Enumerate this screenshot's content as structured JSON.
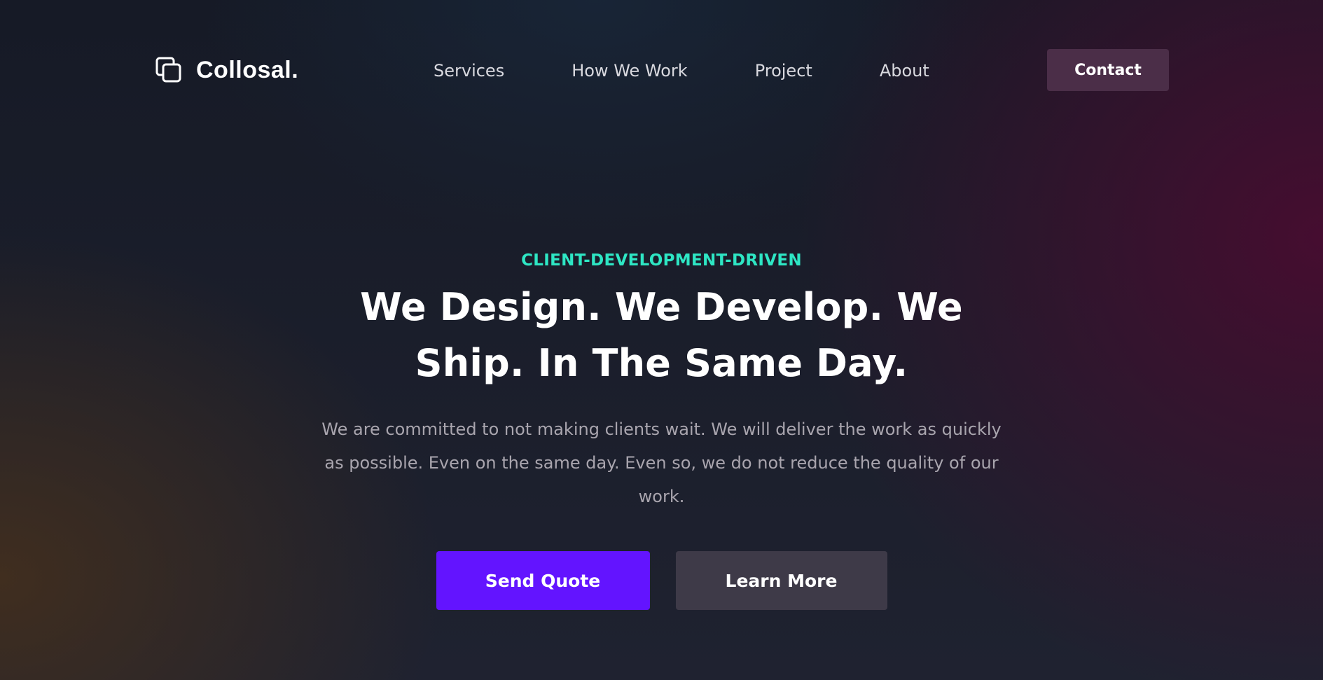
{
  "brand": {
    "name": "Collosal.",
    "icon": "overlapping-squares-icon"
  },
  "nav": {
    "items": [
      {
        "label": "Services"
      },
      {
        "label": "How We Work"
      },
      {
        "label": "Project"
      },
      {
        "label": "About"
      }
    ],
    "contact_label": "Contact"
  },
  "hero": {
    "eyebrow": "CLIENT-DEVELOPMENT-DRIVEN",
    "title": "We Design. We Develop. We Ship. In The Same Day.",
    "description": "We are committed to not making clients wait. We will deliver the work as quickly as possible. Even on the same day. Even so, we do not reduce the quality of our work.",
    "primary_cta": "Send Quote",
    "secondary_cta": "Learn More"
  },
  "colors": {
    "accent_teal": "#2ee6c4",
    "primary_button": "#6314ff",
    "secondary_button": "#3e3a48",
    "contact_button": "#4b2e48",
    "heading_text": "#ffffff",
    "body_text": "#a9a5ae"
  }
}
